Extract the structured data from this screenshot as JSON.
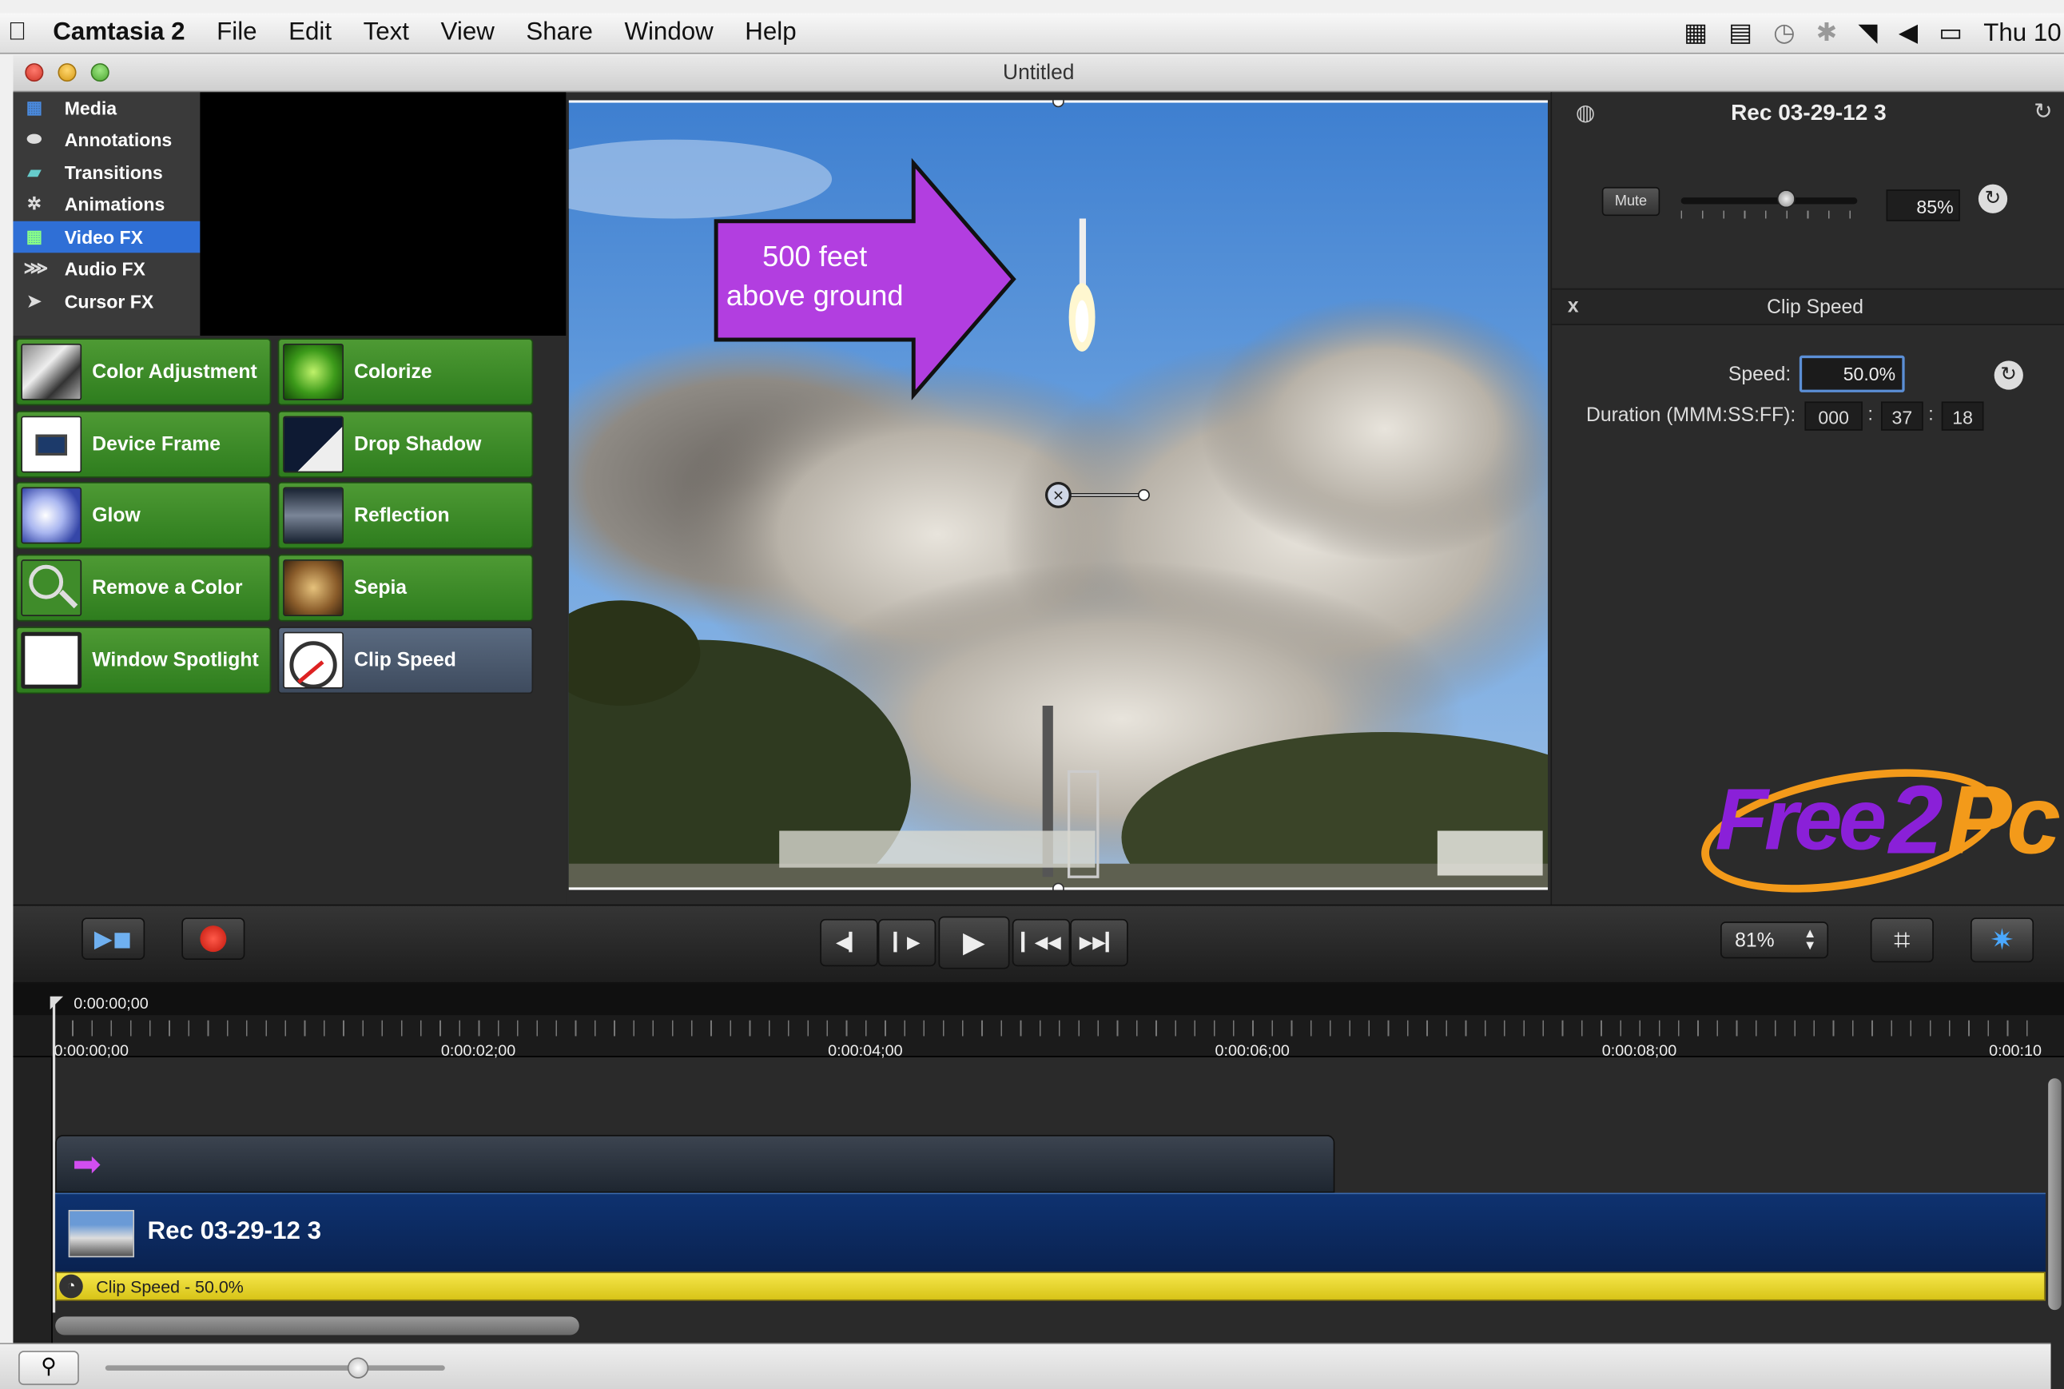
{
  "menubar": {
    "app_name": "Camtasia 2",
    "menus": [
      "File",
      "Edit",
      "Text",
      "View",
      "Share",
      "Window",
      "Help"
    ],
    "clock": "Thu 10"
  },
  "window": {
    "title": "Untitled"
  },
  "library": {
    "items": [
      {
        "label": "Media",
        "icon": "media-icon"
      },
      {
        "label": "Annotations",
        "icon": "annotations-icon"
      },
      {
        "label": "Transitions",
        "icon": "transitions-icon"
      },
      {
        "label": "Animations",
        "icon": "gear-icon"
      },
      {
        "label": "Video FX",
        "icon": "film-icon",
        "selected": true
      },
      {
        "label": "Audio FX",
        "icon": "waveform-icon"
      },
      {
        "label": "Cursor FX",
        "icon": "cursor-icon"
      }
    ]
  },
  "effects": [
    {
      "label": "Color Adjustment"
    },
    {
      "label": "Colorize"
    },
    {
      "label": "Device Frame"
    },
    {
      "label": "Drop Shadow"
    },
    {
      "label": "Glow"
    },
    {
      "label": "Reflection"
    },
    {
      "label": "Remove a Color"
    },
    {
      "label": "Sepia"
    },
    {
      "label": "Window Spotlight"
    },
    {
      "label": "Clip Speed",
      "selected": true
    }
  ],
  "preview": {
    "callout_line1": "500 feet",
    "callout_line2": "above ground"
  },
  "properties": {
    "clip_name": "Rec 03-29-12 3",
    "mute_label": "Mute",
    "volume": "85%",
    "volume_fraction": 0.6,
    "section_title": "Clip Speed",
    "close_label": "x",
    "speed_label": "Speed:",
    "speed_value": "50.0%",
    "duration_label": "Duration (MMM:SS:FF):",
    "duration_min": "000",
    "duration_sec": "37",
    "duration_frames": "18",
    "sep": ":"
  },
  "watermark": {
    "text_a": "Free",
    "text_b": "2",
    "text_c": "Pc"
  },
  "transport": {
    "zoom": "81%"
  },
  "timeline": {
    "playhead_time": "0:00:00;00",
    "ruler_labels": [
      "0:00:00;00",
      "0:00:02;00",
      "0:00:04;00",
      "0:00:06;00",
      "0:00:08;00",
      "0:00:10"
    ],
    "clip_label": "Rec 03-29-12 3",
    "speed_effect_label": "Clip Speed - 50.0%"
  },
  "colors": {
    "selection_blue": "#2f6fd6",
    "fx_green": "#3f8c2a",
    "callout_purple": "#b23ee0",
    "speed_bar_yellow": "#e8d42a",
    "watermark_purple": "#8a20d8",
    "watermark_orange": "#f39a1a"
  }
}
